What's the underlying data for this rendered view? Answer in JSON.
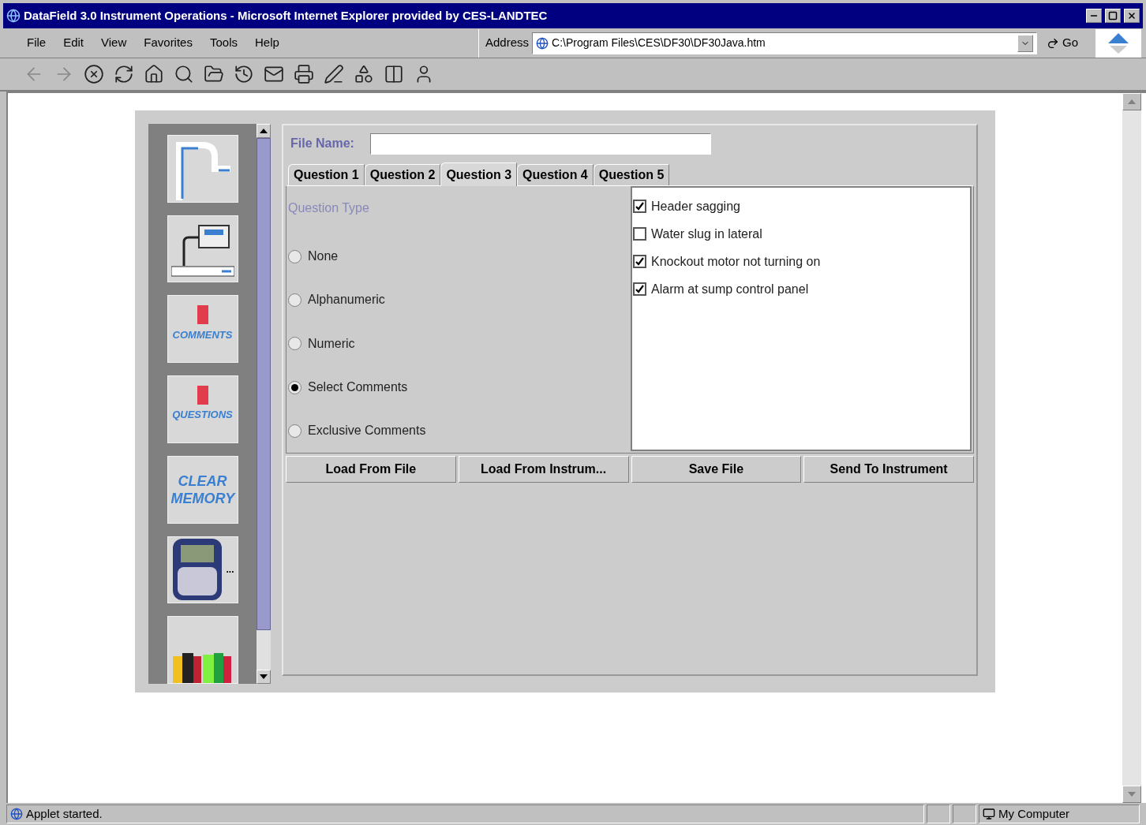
{
  "window": {
    "title": "DataField 3.0 Instrument Operations - Microsoft Internet Explorer provided by CES-LANDTEC"
  },
  "menu": [
    "File",
    "Edit",
    "View",
    "Favorites",
    "Tools",
    "Help"
  ],
  "address": {
    "label": "Address",
    "value": "C:\\Program Files\\CES\\DF30\\DF30Java.htm",
    "go": "Go"
  },
  "sidebar": {
    "tiles": [
      {
        "kind": "pipes"
      },
      {
        "kind": "monitor"
      },
      {
        "kind": "comments",
        "label": "COMMENTS"
      },
      {
        "kind": "questions",
        "label": "QUESTIONS"
      },
      {
        "kind": "clear",
        "label": "CLEAR MEMORY"
      },
      {
        "kind": "device",
        "label": "..."
      },
      {
        "kind": "books"
      }
    ]
  },
  "file_name": {
    "label": "File Name:"
  },
  "tabs": [
    {
      "label": "Question 1",
      "selected": false
    },
    {
      "label": "Question 2",
      "selected": false
    },
    {
      "label": "Question 3",
      "selected": true
    },
    {
      "label": "Question 4",
      "selected": false
    },
    {
      "label": "Question 5",
      "selected": false
    }
  ],
  "question_type": {
    "label": "Question Type",
    "options": [
      {
        "label": "None",
        "selected": false
      },
      {
        "label": "Alphanumeric",
        "selected": false
      },
      {
        "label": "Numeric",
        "selected": false
      },
      {
        "label": "Select Comments",
        "selected": true
      },
      {
        "label": "Exclusive Comments",
        "selected": false
      }
    ]
  },
  "comments": [
    {
      "label": "Header sagging",
      "checked": true
    },
    {
      "label": "Water slug in lateral",
      "checked": false
    },
    {
      "label": "Knockout motor not turning on",
      "checked": true
    },
    {
      "label": "Alarm at sump control panel",
      "checked": true
    }
  ],
  "buttons": [
    "Load From File",
    "Load From Instrum...",
    "Save File",
    "Send To Instrument"
  ],
  "status_bar": {
    "text": "Applet started.",
    "zone": "My Computer"
  }
}
